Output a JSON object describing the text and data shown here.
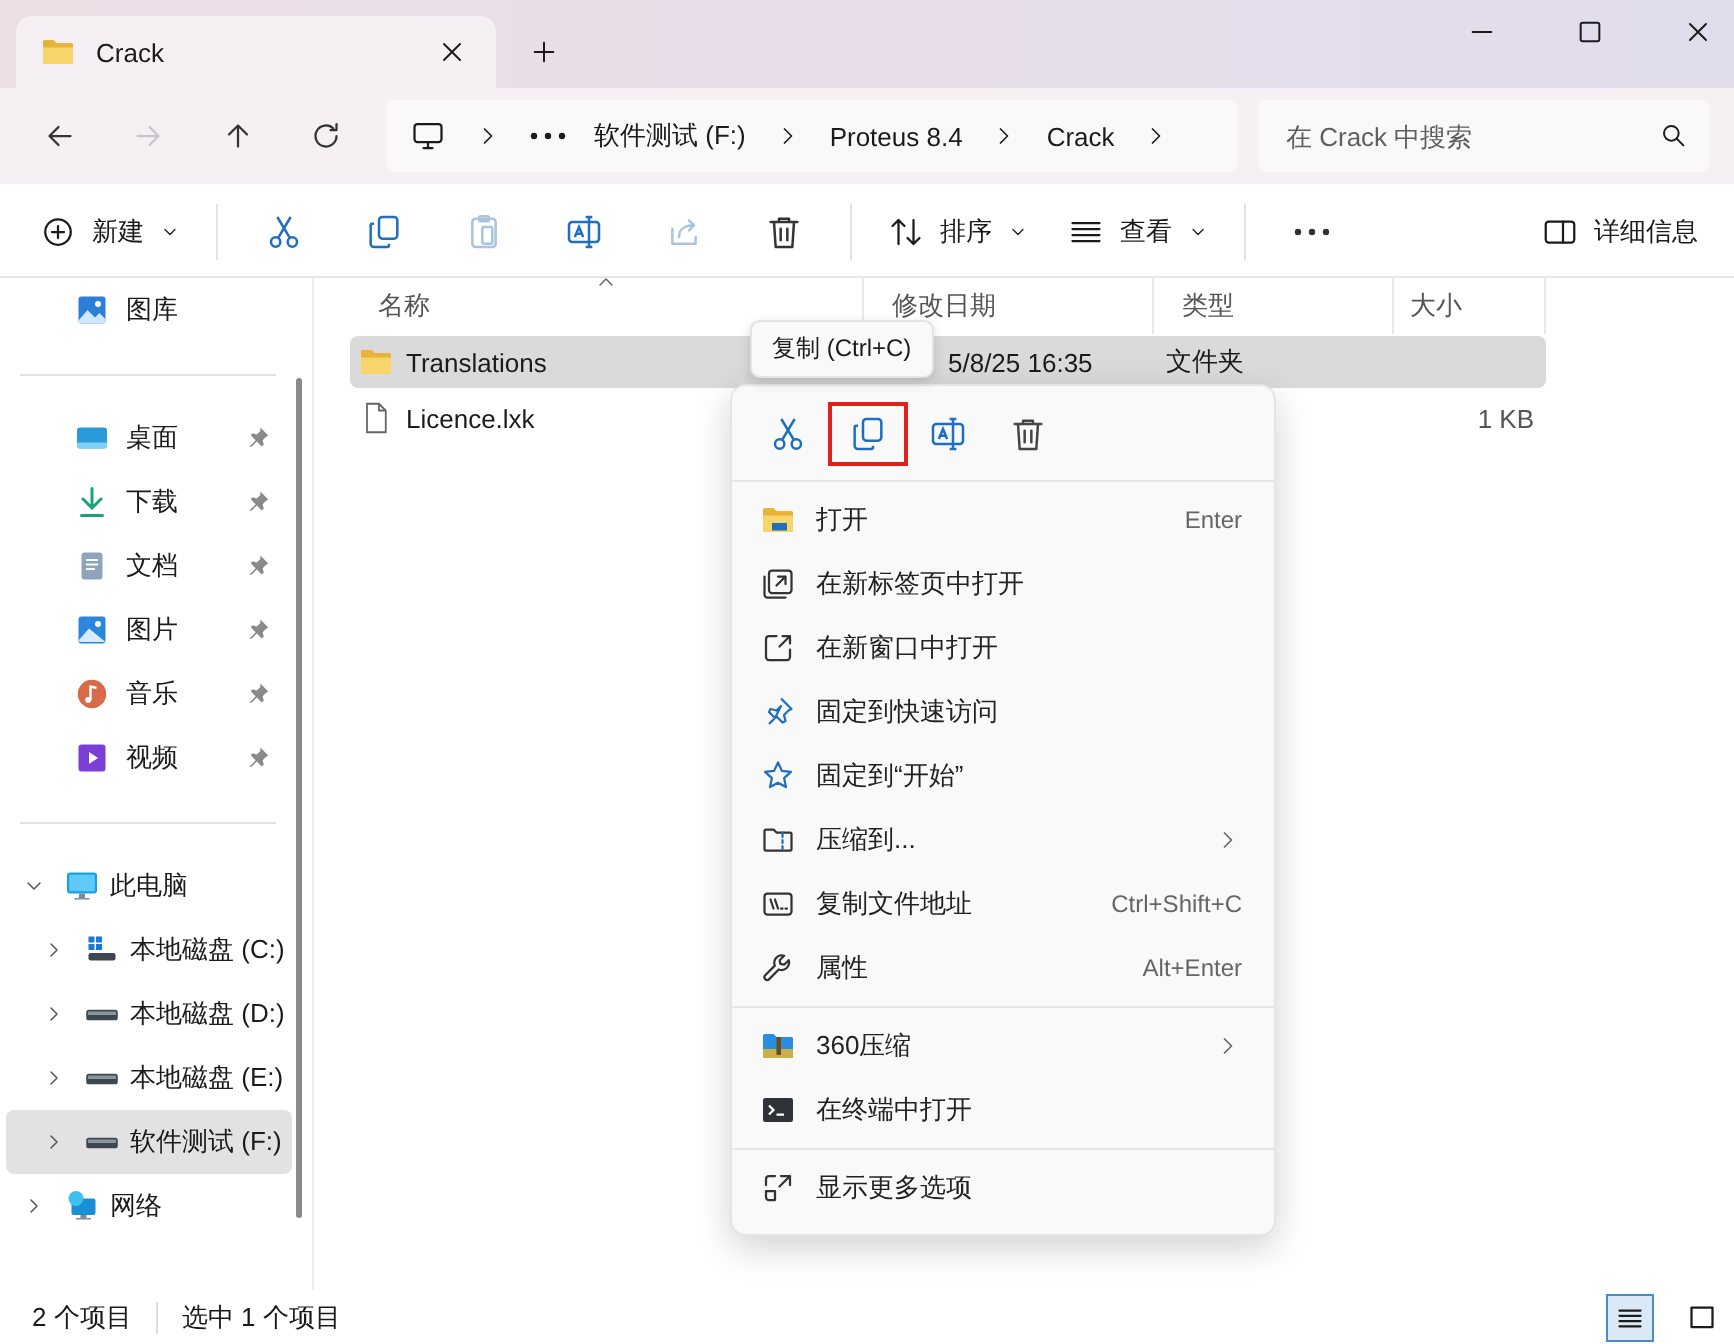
{
  "window": {
    "tab_title": "Crack"
  },
  "nav": [
    {
      "kind": "back",
      "disabled": false
    },
    {
      "kind": "forward",
      "disabled": true
    },
    {
      "kind": "up",
      "disabled": false
    },
    {
      "kind": "refresh",
      "disabled": false
    }
  ],
  "address": {
    "segments": [
      "软件测试 (F:)",
      "Proteus 8.4",
      "Crack"
    ]
  },
  "search": {
    "placeholder": "在 Crack 中搜索"
  },
  "toolbar": {
    "new": "新建",
    "actions": [
      {
        "kind": "cut",
        "disabled": false
      },
      {
        "kind": "copy",
        "disabled": false
      },
      {
        "kind": "paste",
        "disabled": true
      },
      {
        "kind": "rename",
        "disabled": false
      },
      {
        "kind": "share",
        "disabled": true
      },
      {
        "kind": "delete",
        "disabled": false
      }
    ],
    "sort": "排序",
    "view": "查看",
    "details": "详细信息"
  },
  "sidebar": {
    "top": [
      {
        "kind": "gallery",
        "label": "图库"
      }
    ],
    "quick_access": [
      {
        "kind": "desktop",
        "label": "桌面",
        "pinned": true
      },
      {
        "kind": "download",
        "label": "下载",
        "pinned": true
      },
      {
        "kind": "documents",
        "label": "文档",
        "pinned": true
      },
      {
        "kind": "pictures",
        "label": "图片",
        "pinned": true
      },
      {
        "kind": "music",
        "label": "音乐",
        "pinned": true
      },
      {
        "kind": "video",
        "label": "视频",
        "pinned": true
      }
    ],
    "tree": [
      {
        "kind": "pc",
        "label": "此电脑",
        "expanded": true,
        "selected": false,
        "children": [
          {
            "kind": "system-drive",
            "label": "本地磁盘 (C:)",
            "expanded": false,
            "selected": false
          },
          {
            "kind": "drive",
            "label": "本地磁盘 (D:)",
            "expanded": false,
            "selected": false
          },
          {
            "kind": "drive",
            "label": "本地磁盘 (E:)",
            "expanded": false,
            "selected": false
          },
          {
            "kind": "drive",
            "label": "软件测试 (F:)",
            "expanded": false,
            "selected": true
          }
        ]
      },
      {
        "kind": "network",
        "label": "网络",
        "expanded": false,
        "selected": false
      }
    ]
  },
  "table": {
    "columns": [
      {
        "label": "名称",
        "sorted": true
      },
      {
        "label": "修改日期",
        "sorted": false
      },
      {
        "label": "类型",
        "sorted": false
      },
      {
        "label": "大小",
        "sorted": false
      }
    ],
    "rows": [
      {
        "kind": "folder",
        "name": "Translations",
        "modified": "5/8/25 16:35",
        "type": "文件夹",
        "selected": true
      },
      {
        "kind": "file",
        "name": "Licence.lxk",
        "size": "1 KB",
        "selected": false
      }
    ]
  },
  "tooltip": {
    "text": "复制 (Ctrl+C)"
  },
  "context_menu": {
    "actions": [
      {
        "kind": "cut",
        "highlighted": false
      },
      {
        "kind": "copy",
        "highlighted": true
      },
      {
        "kind": "rename",
        "highlighted": false
      },
      {
        "kind": "delete",
        "highlighted": false
      }
    ],
    "groups": [
      [
        {
          "kind": "open",
          "label": "打开",
          "shortcut": "Enter",
          "submenu": false
        },
        {
          "kind": "open-tab",
          "label": "在新标签页中打开",
          "submenu": false
        },
        {
          "kind": "new-window",
          "label": "在新窗口中打开",
          "submenu": false
        },
        {
          "kind": "pin",
          "label": "固定到快速访问",
          "submenu": false
        },
        {
          "kind": "pin-start",
          "label": "固定到“开始”",
          "submenu": false
        },
        {
          "kind": "zip",
          "label": "压缩到...",
          "submenu": true
        },
        {
          "kind": "copy-path",
          "label": "复制文件地址",
          "shortcut": "Ctrl+Shift+C",
          "submenu": false
        },
        {
          "kind": "properties",
          "label": "属性",
          "shortcut": "Alt+Enter",
          "submenu": false
        }
      ],
      [
        {
          "kind": "zip360",
          "label": "360压缩",
          "submenu": true
        },
        {
          "kind": "terminal",
          "label": "在终端中打开",
          "submenu": false
        }
      ],
      [
        {
          "kind": "more",
          "label": "显示更多选项",
          "submenu": false
        }
      ]
    ]
  },
  "status_bar": {
    "count": "2 个项目",
    "selection": "选中 1 个项目",
    "views": [
      {
        "kind": "details",
        "selected": true
      },
      {
        "kind": "tiles",
        "selected": false
      }
    ]
  }
}
